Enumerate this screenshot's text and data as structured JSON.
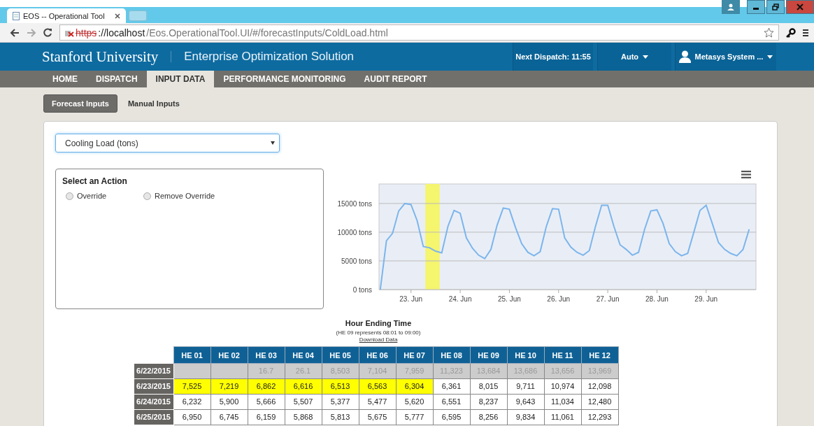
{
  "browser": {
    "tab_title": "EOS -- Operational Tool",
    "url": {
      "scheme": "https",
      "host": "://localhost",
      "path": "/Eos.OperationalTool.UI/#/forecastInputs/ColdLoad.html",
      "insecure": true
    }
  },
  "header": {
    "brand": "Stanford University",
    "app_title": "Enterprise Optimization Solution",
    "next_dispatch": "Next Dispatch: 11:55",
    "mode": "Auto",
    "user": "Metasys System ..."
  },
  "nav": [
    {
      "label": "HOME",
      "selected": false
    },
    {
      "label": "DISPATCH",
      "selected": false
    },
    {
      "label": "INPUT DATA",
      "selected": true
    },
    {
      "label": "PERFORMANCE MONITORING",
      "selected": false
    },
    {
      "label": "AUDIT REPORT",
      "selected": false
    }
  ],
  "subtabs": [
    {
      "label": "Forecast Inputs",
      "selected": true
    },
    {
      "label": "Manual Inputs",
      "selected": false
    }
  ],
  "variable_select": {
    "value": "Cooling Load (tons)"
  },
  "action_panel": {
    "title": "Select an Action",
    "options": [
      {
        "label": "Override",
        "selected": false
      },
      {
        "label": "Remove Override",
        "selected": false
      }
    ]
  },
  "chart": {
    "chart_data": {
      "type": "line",
      "ylim": [
        0,
        18400
      ],
      "yticks": [
        {
          "value": 0,
          "label": "0 tons"
        },
        {
          "value": 5000,
          "label": "5000 tons"
        },
        {
          "value": 10000,
          "label": "10000 tons"
        },
        {
          "value": 15000,
          "label": "15000 tons"
        }
      ],
      "categories": [
        null,
        null,
        null,
        null,
        null,
        "23. Jun",
        null,
        null,
        null,
        null,
        null,
        null,
        null,
        "24. Jun",
        null,
        null,
        null,
        null,
        null,
        null,
        null,
        "25. Jun",
        null,
        null,
        null,
        null,
        null,
        null,
        null,
        "26. Jun",
        null,
        null,
        null,
        null,
        null,
        null,
        null,
        "27. Jun",
        null,
        null,
        null,
        null,
        null,
        null,
        null,
        "28. Jun",
        null,
        null,
        null,
        null,
        null,
        null,
        null,
        "29. Jun",
        null,
        null,
        null,
        null,
        null,
        null,
        null
      ],
      "series": [
        {
          "color": "#7cb5ec",
          "values": [
            0,
            8500,
            9800,
            13700,
            15000,
            14800,
            12000,
            7500,
            7300,
            6700,
            6400,
            11000,
            13800,
            13300,
            9000,
            7200,
            6000,
            5400,
            7000,
            11200,
            14200,
            14000,
            10800,
            8000,
            6500,
            5900,
            6600,
            11000,
            14100,
            14000,
            9000,
            7400,
            6500,
            6000,
            6800,
            11000,
            14700,
            14700,
            11000,
            7800,
            7000,
            6000,
            6500,
            10500,
            13700,
            13900,
            11500,
            8000,
            6600,
            5900,
            6300,
            10000,
            13800,
            14700,
            11500,
            8200,
            7000,
            6300,
            5900,
            7000,
            10500
          ]
        }
      ],
      "grid": true
    }
  },
  "table": {
    "title": "Hour Ending Time",
    "note": "(HE 09 represents 08:01 to 09:00)",
    "download_link": "Download Data",
    "columns": [
      "HE 01",
      "HE 02",
      "HE 03",
      "HE 04",
      "HE 05",
      "HE 06",
      "HE 07",
      "HE 08",
      "HE 09",
      "HE 10",
      "HE 11",
      "HE 12"
    ],
    "rows": [
      {
        "date": "6/22/2015",
        "past": true,
        "cells": [
          {
            "highlighted": false
          },
          {
            "highlighted": false
          },
          {
            "value": "16.7",
            "highlighted": false
          },
          {
            "value": "26.1",
            "highlighted": false
          },
          {
            "value": "8,503",
            "highlighted": false
          },
          {
            "value": "7,104",
            "highlighted": false
          },
          {
            "value": "7,959",
            "highlighted": false
          },
          {
            "value": "11,323",
            "highlighted": false
          },
          {
            "value": "13,684",
            "highlighted": false
          },
          {
            "value": "13,686",
            "highlighted": false
          },
          {
            "value": "13,656",
            "highlighted": false
          },
          {
            "value": "13,969",
            "highlighted": false
          }
        ]
      },
      {
        "date": "6/23/2015",
        "past": false,
        "cells": [
          {
            "value": "7,525",
            "highlighted": true
          },
          {
            "value": "7,219",
            "highlighted": true
          },
          {
            "value": "6,862",
            "highlighted": true
          },
          {
            "value": "6,616",
            "highlighted": true
          },
          {
            "value": "6,513",
            "highlighted": true
          },
          {
            "value": "6,563",
            "highlighted": true
          },
          {
            "value": "6,304",
            "highlighted": true
          },
          {
            "value": "6,361",
            "highlighted": false
          },
          {
            "value": "8,015",
            "highlighted": false
          },
          {
            "value": "9,711",
            "highlighted": false
          },
          {
            "value": "10,974",
            "highlighted": false
          },
          {
            "value": "12,098",
            "highlighted": false
          }
        ]
      },
      {
        "date": "6/24/2015",
        "past": false,
        "cells": [
          {
            "value": "6,232",
            "highlighted": false
          },
          {
            "value": "5,900",
            "highlighted": false
          },
          {
            "value": "5,666",
            "highlighted": false
          },
          {
            "value": "5,507",
            "highlighted": false
          },
          {
            "value": "5,377",
            "highlighted": false
          },
          {
            "value": "5,477",
            "highlighted": false
          },
          {
            "value": "5,620",
            "highlighted": false
          },
          {
            "value": "6,551",
            "highlighted": false
          },
          {
            "value": "8,237",
            "highlighted": false
          },
          {
            "value": "9,643",
            "highlighted": false
          },
          {
            "value": "11,034",
            "highlighted": false
          },
          {
            "value": "12,480",
            "highlighted": false
          }
        ]
      },
      {
        "date": "6/25/2015",
        "past": false,
        "cells": [
          {
            "value": "6,950",
            "highlighted": false
          },
          {
            "value": "6,745",
            "highlighted": false
          },
          {
            "value": "6,159",
            "highlighted": false
          },
          {
            "value": "5,868",
            "highlighted": false
          },
          {
            "value": "5,813",
            "highlighted": false
          },
          {
            "value": "5,675",
            "highlighted": false
          },
          {
            "value": "5,777",
            "highlighted": false
          },
          {
            "value": "6,595",
            "highlighted": false
          },
          {
            "value": "8,256",
            "highlighted": false
          },
          {
            "value": "9,834",
            "highlighted": false
          },
          {
            "value": "11,061",
            "highlighted": false
          },
          {
            "value": "12,293",
            "highlighted": false
          }
        ]
      }
    ]
  }
}
